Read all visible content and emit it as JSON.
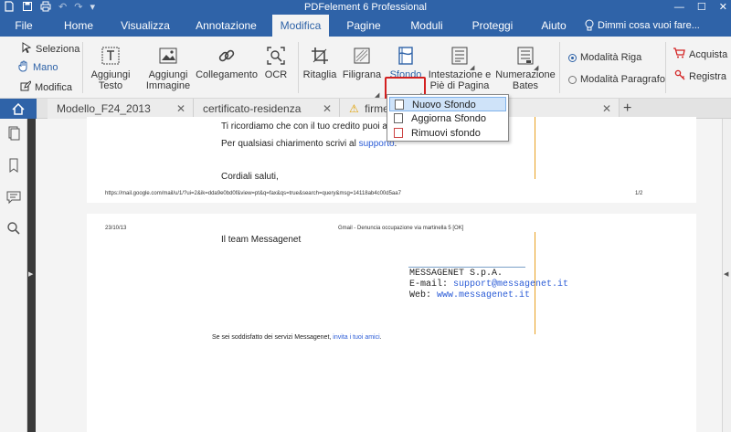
{
  "app": {
    "title": "PDFelement 6 Professional"
  },
  "window_controls": {
    "minimize": "—",
    "maximize": "☐",
    "close": "✕"
  },
  "menu": {
    "items": [
      "File",
      "Home",
      "Visualizza",
      "Annotazione",
      "Modifica",
      "Pagine",
      "Moduli",
      "Proteggi",
      "Aiuto"
    ],
    "active": "Modifica",
    "tell_me": "Dimmi cosa vuoi fare..."
  },
  "ribbon": {
    "select": "Seleziona",
    "hand": "Mano",
    "edit": "Modifica",
    "add_text": [
      "Aggiungi",
      "Testo"
    ],
    "add_image": [
      "Aggiungi",
      "Immagine"
    ],
    "link": "Collegamento",
    "ocr": "OCR",
    "crop": "Ritaglia",
    "watermark": "Filigrana",
    "background": "Sfondo",
    "header_footer": [
      "Intestazione e",
      "Piè di Pagina"
    ],
    "bates": [
      "Numerazione",
      "Bates"
    ],
    "mode_line": "Modalità Riga",
    "mode_paragraph": "Modalità Paragrafo",
    "buy": "Acquista",
    "register": "Registra",
    "accent": "#2f63a8",
    "highlight_color": "#d32020"
  },
  "tabs": [
    {
      "label": "Modello_F24_2013",
      "close": "✕"
    },
    {
      "label": "certificato-residenza",
      "close": "✕"
    },
    {
      "label": "firme_n",
      "close": "✕",
      "warning": "⚠"
    }
  ],
  "new_tab": "+",
  "dropdown": {
    "items": [
      "Nuovo Sfondo",
      "Aggiorna Sfondo",
      "Rimuovi sfondo"
    ],
    "selected": "Nuovo Sfondo"
  },
  "document": {
    "page1": {
      "line1": "Ti ricordiamo che con il tuo credito puoi anche",
      "line2_prefix": "Per qualsiasi chiarimento scrivi al ",
      "line2_link": "supporto",
      "line2_suffix": ".",
      "closing": "Cordiali saluti,",
      "footer_url": "https://mail.google.com/mail/u/1/?ui=2&ik=dda9e0bd0f&view=pt&q=fax&qs=true&search=query&msg=14118ab4c00d5aa7",
      "footer_page": "1/2"
    },
    "page2": {
      "header_date": "23/10/13",
      "header_title": "Gmail - Denuncia occupazione via martinella 5 [OK]",
      "team": "Il team Messagenet",
      "company": "MESSAGENET S.p.A.",
      "email_label": "E-mail: ",
      "email": "support@messagenet.it",
      "web_label": "Web: ",
      "web": "www.messagenet.it",
      "promo_prefix": "Se sei soddisfatto dei servizi Messagenet, ",
      "promo_link": "invita i tuoi amici",
      "promo_suffix": "."
    }
  }
}
